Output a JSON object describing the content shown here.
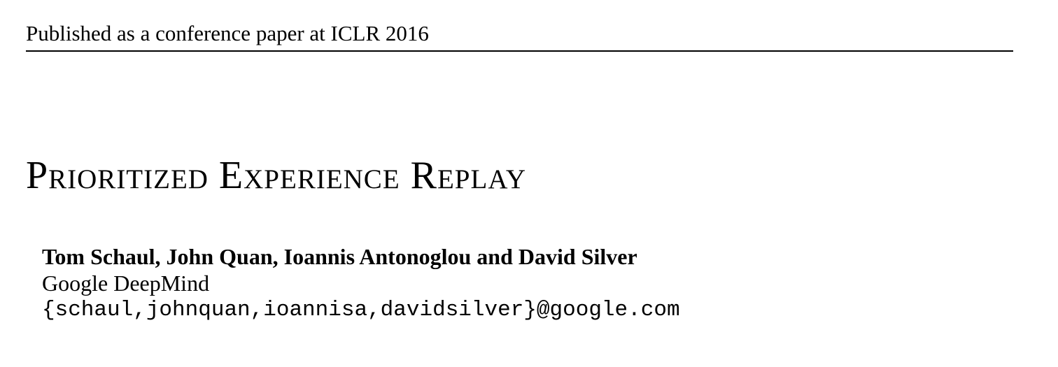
{
  "header": {
    "running_head": "Published as a conference paper at ICLR 2016"
  },
  "paper": {
    "title": "Prioritized Experience Replay",
    "authors": "Tom Schaul, John Quan, Ioannis Antonoglou and David Silver",
    "affiliation": "Google DeepMind",
    "email": "{schaul,johnquan,ioannisa,davidsilver}@google.com"
  }
}
